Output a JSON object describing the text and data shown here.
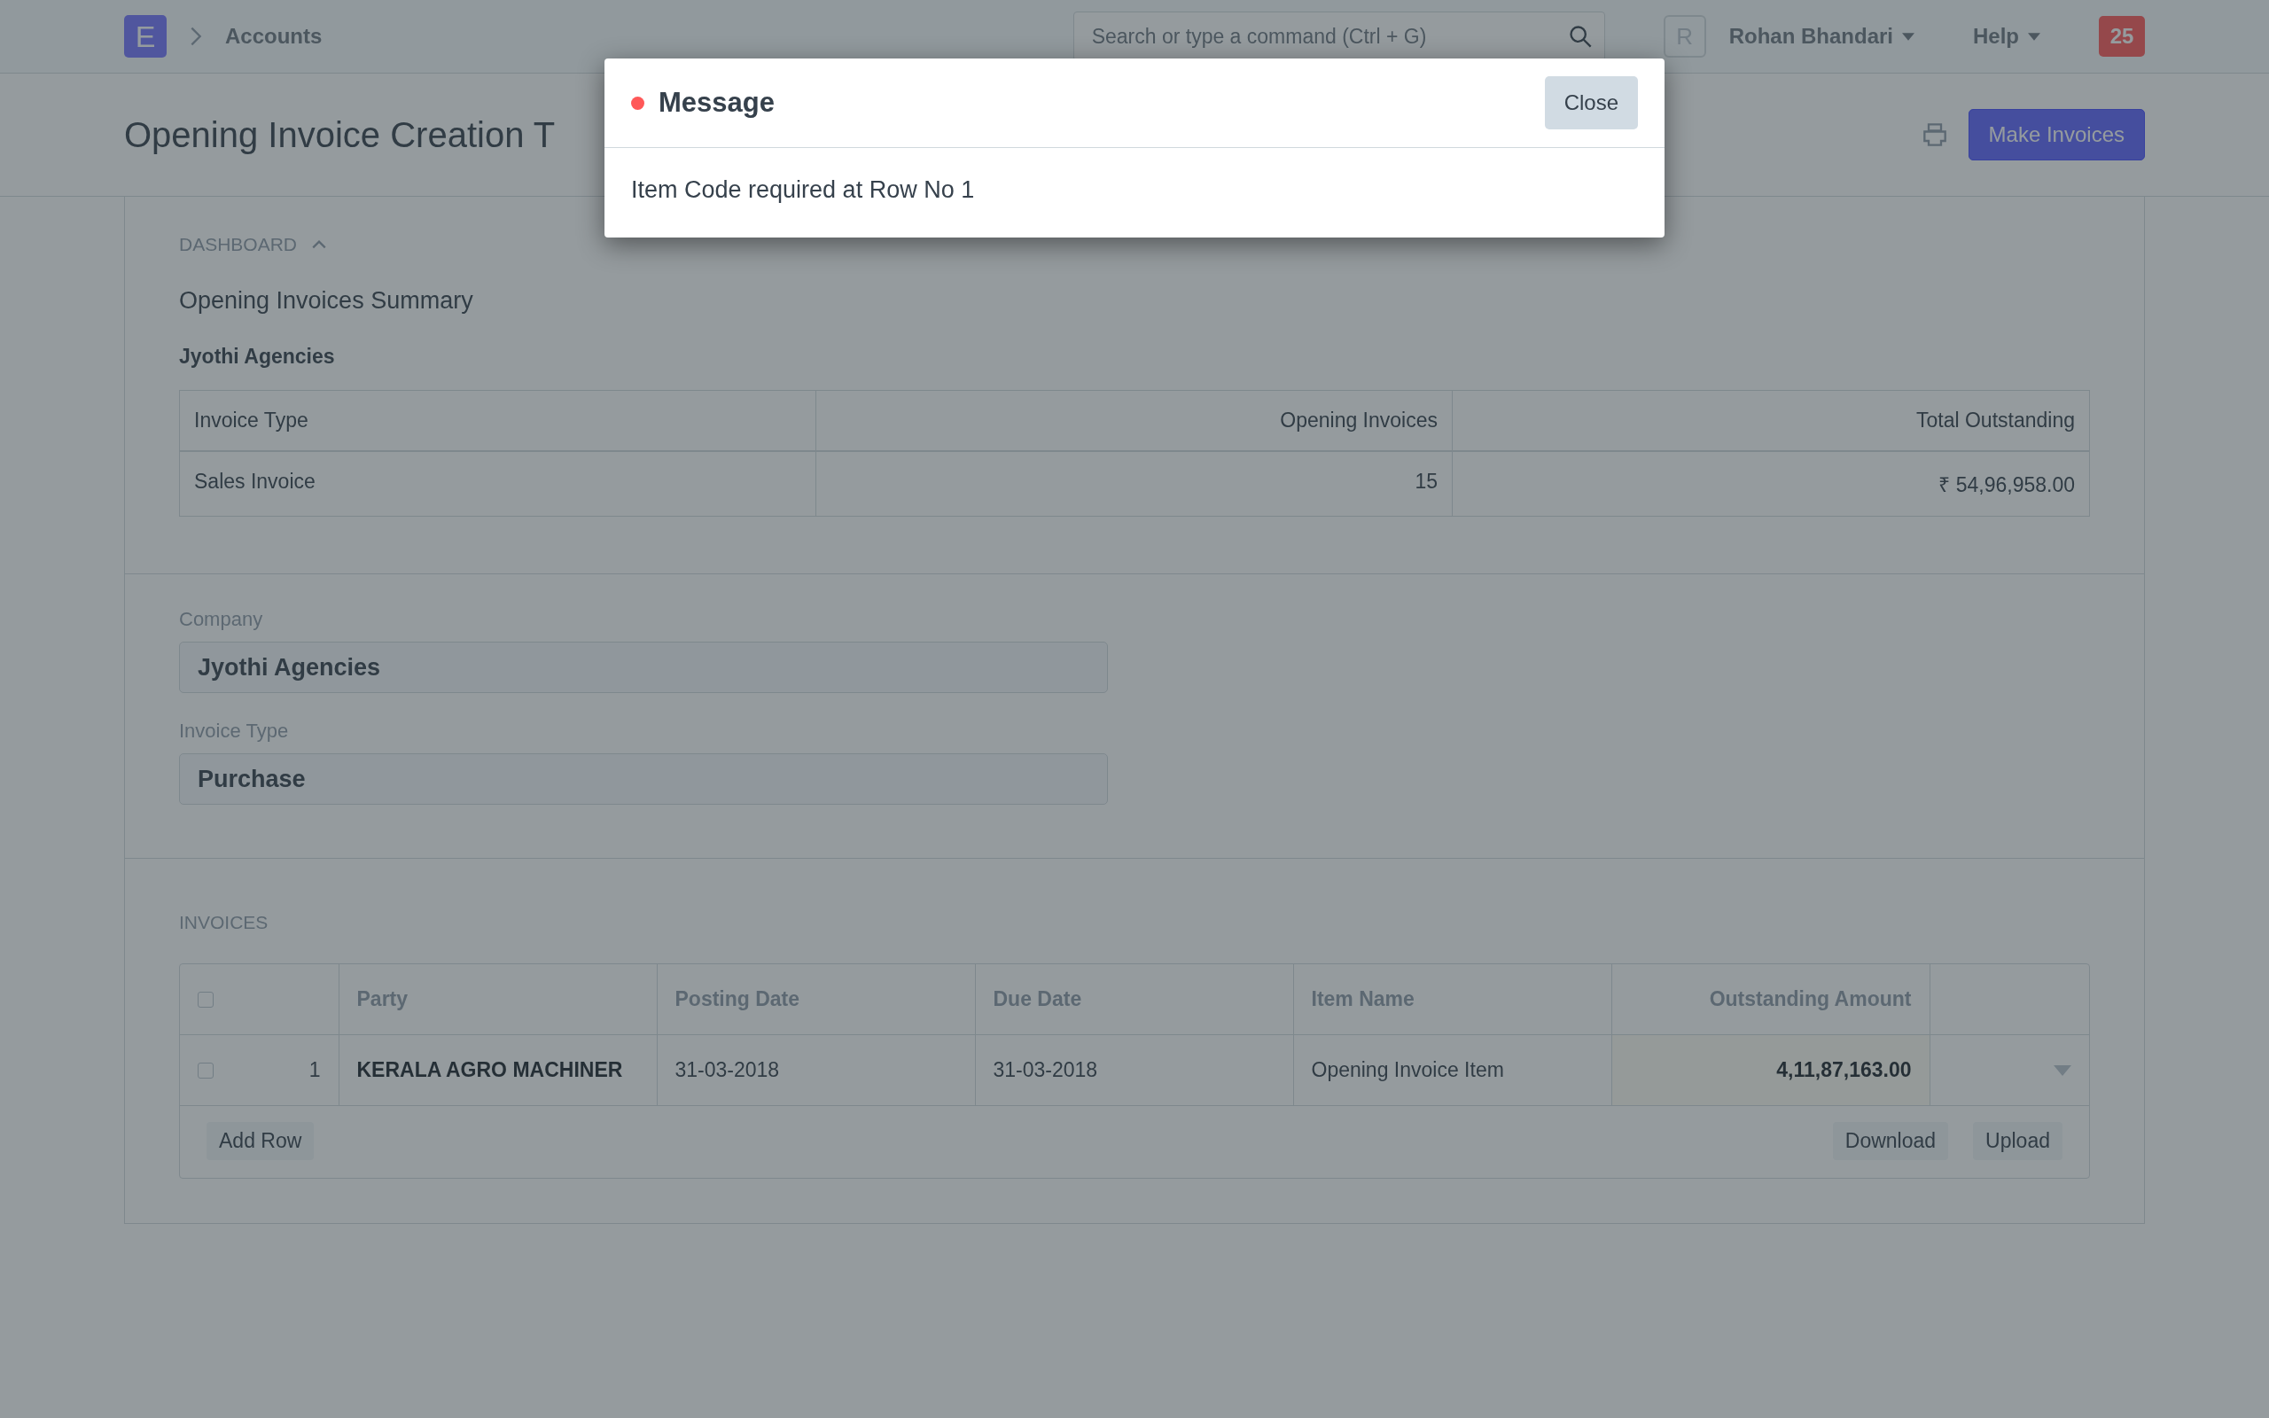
{
  "navbar": {
    "logo": "E",
    "breadcrumb": "Accounts",
    "search": {
      "placeholder": "Search or type a command (Ctrl + G)"
    },
    "avatar": "R",
    "user": "Rohan Bhandari",
    "help": "Help",
    "notifications": "25"
  },
  "page": {
    "title": "Opening Invoice Creation T",
    "primary_action": "Make Invoices"
  },
  "dashboard": {
    "label": "DASHBOARD",
    "expanded": true,
    "heading": "Opening Invoices Summary",
    "company": "Jyothi Agencies",
    "columns": [
      "Invoice Type",
      "Opening Invoices",
      "Total Outstanding"
    ],
    "rows": [
      [
        "Sales Invoice",
        "15",
        "₹ 54,96,958.00"
      ]
    ]
  },
  "fields": [
    {
      "label": "Company",
      "value": "Jyothi Agencies"
    },
    {
      "label": "Invoice Type",
      "value": "Purchase"
    }
  ],
  "invoices": {
    "label": "INVOICES",
    "all_checked": false,
    "columns": [
      "Party",
      "Posting Date",
      "Due Date",
      "Item Name",
      "Outstanding Amount"
    ],
    "rows": [
      {
        "index": "1",
        "checked": false,
        "cells": [
          "KERALA AGRO MACHINER",
          "31-03-2018",
          "31-03-2018",
          "Opening Invoice Item",
          "4,11,87,163.00"
        ]
      }
    ],
    "add_row": "Add Row",
    "buttons": [
      "Download",
      "Upload"
    ]
  },
  "modal": {
    "title": "Message",
    "close": "Close",
    "body": "Item Code required at Row No 1"
  }
}
